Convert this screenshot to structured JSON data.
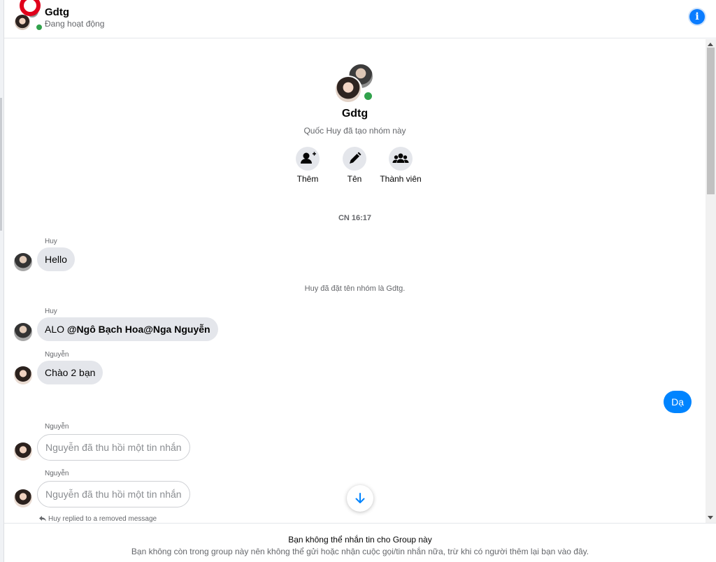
{
  "header": {
    "title": "Gdtg",
    "status": "Đang hoạt động",
    "info_icon": "i",
    "icons": {
      "info": "info-icon"
    }
  },
  "intro": {
    "group_name": "Gdtg",
    "created_by": "Quốc Huy đã tạo nhóm này",
    "actions": [
      {
        "label": "Thêm",
        "icon": "add-person-icon"
      },
      {
        "label": "Tên",
        "icon": "pencil-icon"
      },
      {
        "label": "Thành viên",
        "icon": "members-icon"
      }
    ]
  },
  "timestamp": "CN 16:17",
  "system_note": "Huy đã đặt tên nhóm là Gdtg.",
  "messages": [
    {
      "sender": "Huy",
      "text": "Hello"
    },
    {
      "sender": "Huy",
      "text_prefix": "ALO ",
      "mention1": "@Ngô Bạch Hoa",
      "mention2": "@Nga Nguyễn"
    },
    {
      "sender": "Nguyễn",
      "text": "Chào 2 bạn"
    },
    {
      "sender": "me",
      "text": "Dạ"
    },
    {
      "sender": "Nguyễn",
      "text": "Nguyễn đã thu hồi một tin nhắn"
    },
    {
      "sender": "Nguyễn",
      "text": "Nguyễn đã thu hồi một tin nhắn"
    }
  ],
  "reply_note": "Huy replied to a removed message",
  "footer": {
    "title": "Bạn không thể nhắn tin cho Group này",
    "description": "Bạn không còn trong group này nên không thể gửi hoặc nhận cuộc gọi/tin nhắn nữa, trừ khi có người thêm lại bạn vào đây."
  },
  "colors": {
    "accent": "#0084ff",
    "bubble_grey": "#e4e6eb",
    "online": "#31a24c",
    "secondary_text": "#65676b"
  }
}
